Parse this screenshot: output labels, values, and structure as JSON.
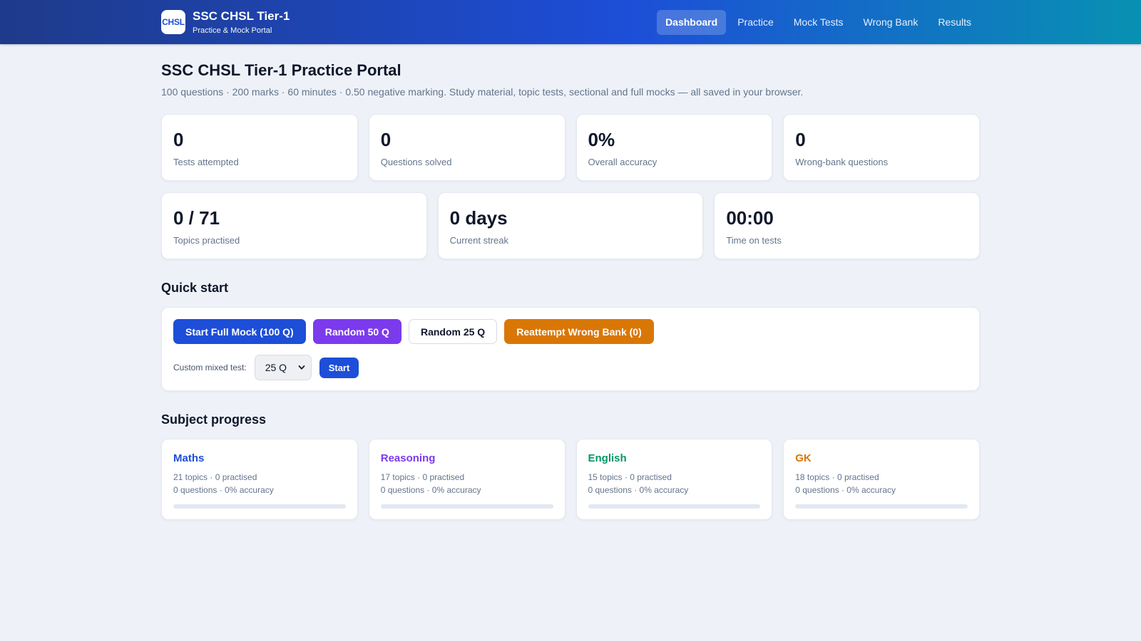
{
  "header": {
    "logo_text": "CHSL",
    "title": "SSC CHSL Tier-1",
    "subtitle": "Practice & Mock Portal",
    "nav": [
      {
        "label": "Dashboard",
        "active": true
      },
      {
        "label": "Practice"
      },
      {
        "label": "Mock Tests"
      },
      {
        "label": "Wrong Bank"
      },
      {
        "label": "Results"
      }
    ]
  },
  "page": {
    "title": "SSC CHSL Tier-1 Practice Portal",
    "subtitle": "100 questions · 200 marks · 60 minutes · 0.50 negative marking. Study material, topic tests, sectional and full mocks — all saved in your browser."
  },
  "stats_top": [
    {
      "value": "0",
      "label": "Tests attempted"
    },
    {
      "value": "0",
      "label": "Questions solved"
    },
    {
      "value": "0%",
      "label": "Overall accuracy"
    },
    {
      "value": "0",
      "label": "Wrong-bank questions"
    }
  ],
  "stats_bottom": [
    {
      "value": "0 / 71",
      "label": "Topics practised"
    },
    {
      "value": "0 days",
      "label": "Current streak"
    },
    {
      "value": "00:00",
      "label": "Time on tests"
    }
  ],
  "quick_start": {
    "title": "Quick start",
    "buttons": {
      "full_mock": "Start Full Mock (100 Q)",
      "random_50": "Random 50 Q",
      "random_25": "Random 25 Q",
      "reattempt": "Reattempt Wrong Bank (0)"
    },
    "custom_label": "Custom mixed test:",
    "custom_select_value": "25 Q",
    "start_label": "Start"
  },
  "subject_progress": {
    "title": "Subject progress",
    "subjects": [
      {
        "name": "Maths",
        "topics_line": "21 topics · 0 practised",
        "stats_line": "0 questions · 0% accuracy",
        "progress": 0,
        "color": "#1d4ed8"
      },
      {
        "name": "Reasoning",
        "topics_line": "17 topics · 0 practised",
        "stats_line": "0 questions · 0% accuracy",
        "progress": 0,
        "color": "#7c3aed"
      },
      {
        "name": "English",
        "topics_line": "15 topics · 0 practised",
        "stats_line": "0 questions · 0% accuracy",
        "progress": 0,
        "color": "#059669"
      },
      {
        "name": "GK",
        "topics_line": "18 topics · 0 practised",
        "stats_line": "0 questions · 0% accuracy",
        "progress": 0,
        "color": "#d97706"
      }
    ]
  },
  "colors": {
    "primary": "#1d4ed8",
    "purple": "#7c3aed",
    "orange": "#d97706",
    "green": "#059669"
  }
}
